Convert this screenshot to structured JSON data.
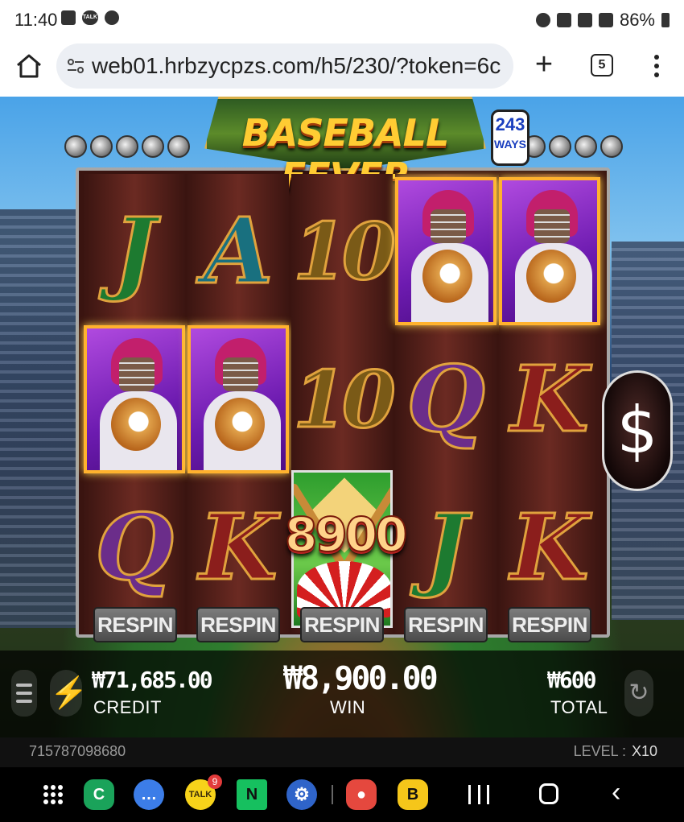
{
  "status_bar": {
    "time": "11:40",
    "battery_text": "86%",
    "left_icons": [
      "gallery-icon",
      "kakaotalk-icon",
      "dnd-icon"
    ],
    "right_icons": [
      "alarm-icon",
      "mute-icon",
      "5g-icon",
      "signal-icon",
      "battery-icon"
    ],
    "talk_label": "TALK"
  },
  "browser": {
    "url": "web01.hrbzycpzs.com/h5/230/?token=6c",
    "tab_count": "5",
    "new_tab_glyph": "+"
  },
  "game": {
    "title": "BASEBALL FEVER",
    "ways_number": "243",
    "ways_label": "WAYS",
    "reels": [
      [
        "J",
        "catcher",
        "Q"
      ],
      [
        "A",
        "catcher",
        "K"
      ],
      [
        "10",
        "10",
        "bonus"
      ],
      [
        "catcher",
        "Q",
        "J"
      ],
      [
        "catcher",
        "K",
        "K"
      ]
    ],
    "bonus_win_amount": "8900",
    "respin_label": "RESPIN",
    "dollar_symbol": "$",
    "hud": {
      "credit_value": "₩71,685.00",
      "credit_label": "CREDIT",
      "win_value": "₩8,900.00",
      "win_label": "WIN",
      "total_value": "₩600",
      "total_label": "TOTAL"
    },
    "game_id": "715787098680",
    "level_label": "LEVEL :",
    "level_value": "X10"
  },
  "nav": {
    "talk_badge": "9",
    "app_icons": [
      "apps-grid-icon",
      "c-app-icon",
      "messages-icon",
      "kakaotalk-icon",
      "naver-icon",
      "settings-icon",
      "piggy-bank-icon",
      "b-app-icon"
    ],
    "app_letters": {
      "c": "C",
      "n": "N",
      "b": "B",
      "talk": "TALK"
    }
  }
}
